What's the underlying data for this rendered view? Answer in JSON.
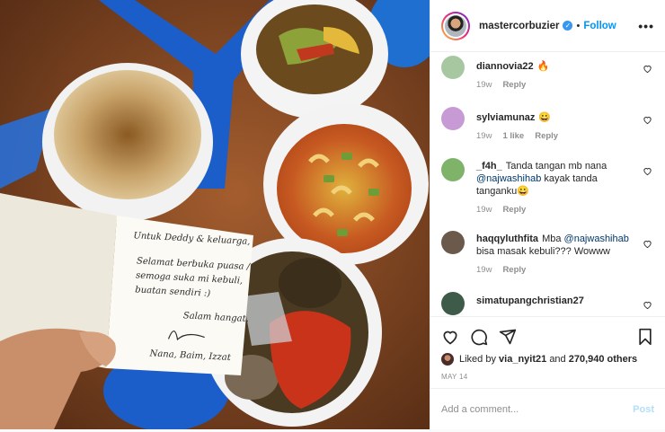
{
  "post": {
    "username": "mastercorbuzier",
    "follow_label": "Follow",
    "more_label": "•••"
  },
  "note": {
    "lines": [
      "Untuk Deddy & keluarga,",
      "Selamat berbuka puasa /",
      "semoga suka mi kebuli,",
      "buatan sendiri :)",
      "Salam hangat,",
      "Nana, Baim, Izzat"
    ]
  },
  "comments": [
    {
      "user": "diannovia22",
      "text": "🔥",
      "time": "19w",
      "likes": "",
      "reply": "Reply",
      "avatar_color": "#a7c7a0"
    },
    {
      "user": "sylviamunaz",
      "text": "😀",
      "time": "19w",
      "likes": "1 like",
      "reply": "Reply",
      "avatar_color": "#c79ad6"
    },
    {
      "user": "_f4h_",
      "text": "Tanda tangan mb nana",
      "mention": "@najwashihab",
      "text_after": "kayak tanda tanganku😀",
      "time": "19w",
      "likes": "",
      "reply": "Reply",
      "avatar_color": "#7fb36a"
    },
    {
      "user": "haqqyluthfita",
      "text": "Mba",
      "mention": "@najwashihab",
      "text_after": "bisa masak kebuli??? Wowww",
      "time": "19w",
      "likes": "",
      "reply": "Reply",
      "avatar_color": "#6b5a4c"
    },
    {
      "user": "simatupangchristian27",
      "text": "",
      "time": "",
      "likes": "",
      "reply": "",
      "avatar_color": "#3e5a48"
    }
  ],
  "likes": {
    "prefix": "Liked by",
    "user": "via_nyit21",
    "connector": "and",
    "count": "270,940 others"
  },
  "date": "MAY 14",
  "add_comment": {
    "placeholder": "Add a comment...",
    "post_label": "Post"
  },
  "colors": {
    "accent": "#0095f6",
    "verified": "#3897f0",
    "muted": "#8e8e8e"
  },
  "icons": [
    "verified-badge-icon",
    "heart-icon",
    "comment-icon",
    "share-icon",
    "bookmark-icon",
    "more-options-icon"
  ]
}
